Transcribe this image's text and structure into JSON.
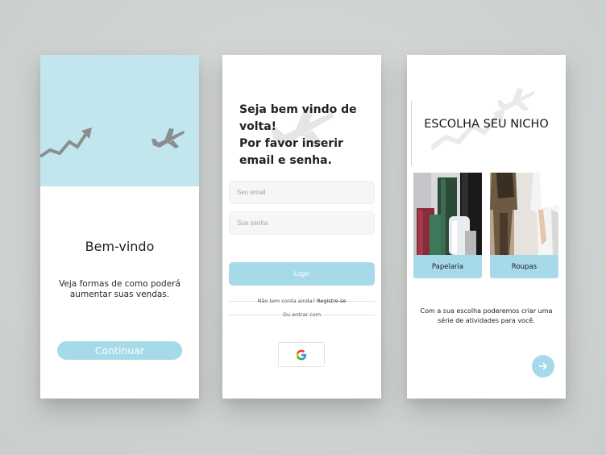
{
  "screens": {
    "welcome": {
      "title": "Bem-vindo",
      "subtitle": "Veja formas de como poderá aumentar suas vendas.",
      "continue_label": "Continuar"
    },
    "login": {
      "title": "Seja bem vindo de volta!\nPor favor inserir email e senha.",
      "email_placeholder": "Seu email",
      "password_placeholder": "Sua senha",
      "login_label": "Login",
      "no_account": "Não tem conta ainda?",
      "register_label": "Registre-se",
      "or_sign_in_with": "Ou entrar com"
    },
    "niche": {
      "title": "ESCOLHA SEU NICHO",
      "options": [
        {
          "label": "Papelaria"
        },
        {
          "label": "Roupas"
        }
      ],
      "description": "Com a sua escolha poderemos criar uma série de atividades para você."
    }
  },
  "colors": {
    "accent": "#a6dae8",
    "hero_bg": "#c1e6ee",
    "page_bg": "#cfd3d2",
    "icon_gray": "#8a8e90"
  },
  "icons": {
    "trend": "trending-up-icon",
    "plane": "airplane-icon",
    "google": "google-icon",
    "next": "arrow-right-icon"
  }
}
